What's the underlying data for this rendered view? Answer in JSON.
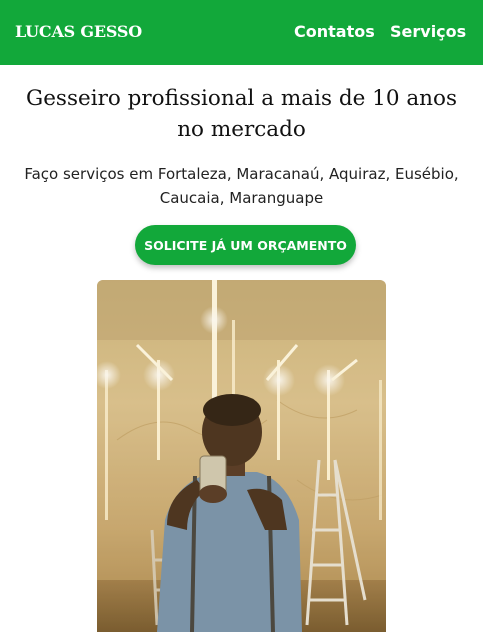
{
  "navbar": {
    "brand": "LUCAS GESSO",
    "links": [
      {
        "label": "Contatos"
      },
      {
        "label": "Serviços"
      }
    ],
    "background_color": "#12a83a"
  },
  "hero": {
    "headline": "Gesseiro profissional a mais de 10 anos no mercado",
    "subtext": "Faço serviços em Fortaleza, Maracanaú, Aquiraz, Eusébio, Caucaia, Maranguape",
    "cta_label": "SOLICITE JÁ UM ORÇAMENTO",
    "cta_color": "#12a83a"
  },
  "photo": {
    "icon": "worker-selfie-photo"
  }
}
